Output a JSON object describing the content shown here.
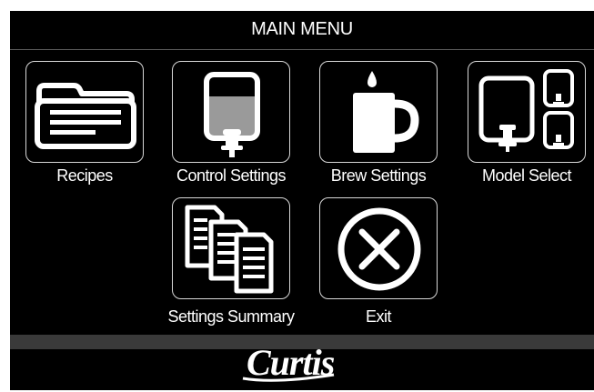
{
  "header": {
    "title": "MAIN MENU"
  },
  "menu": [
    {
      "label": "Recipes",
      "icon": "folder-icon"
    },
    {
      "label": "Control Settings",
      "icon": "water-tank-icon"
    },
    {
      "label": "Brew Settings",
      "icon": "coffee-mug-icon"
    },
    {
      "label": "Model Select",
      "icon": "dispenser-models-icon"
    },
    {
      "label": "Settings Summary",
      "icon": "documents-icon"
    },
    {
      "label": "Exit",
      "icon": "close-circle-icon"
    }
  ],
  "brand": {
    "logo": "Curtis",
    "colors": {
      "background": "#000000",
      "foreground": "#ffffff",
      "tank_fill": "#9a9a9a",
      "band": "#3a3a3a"
    }
  }
}
